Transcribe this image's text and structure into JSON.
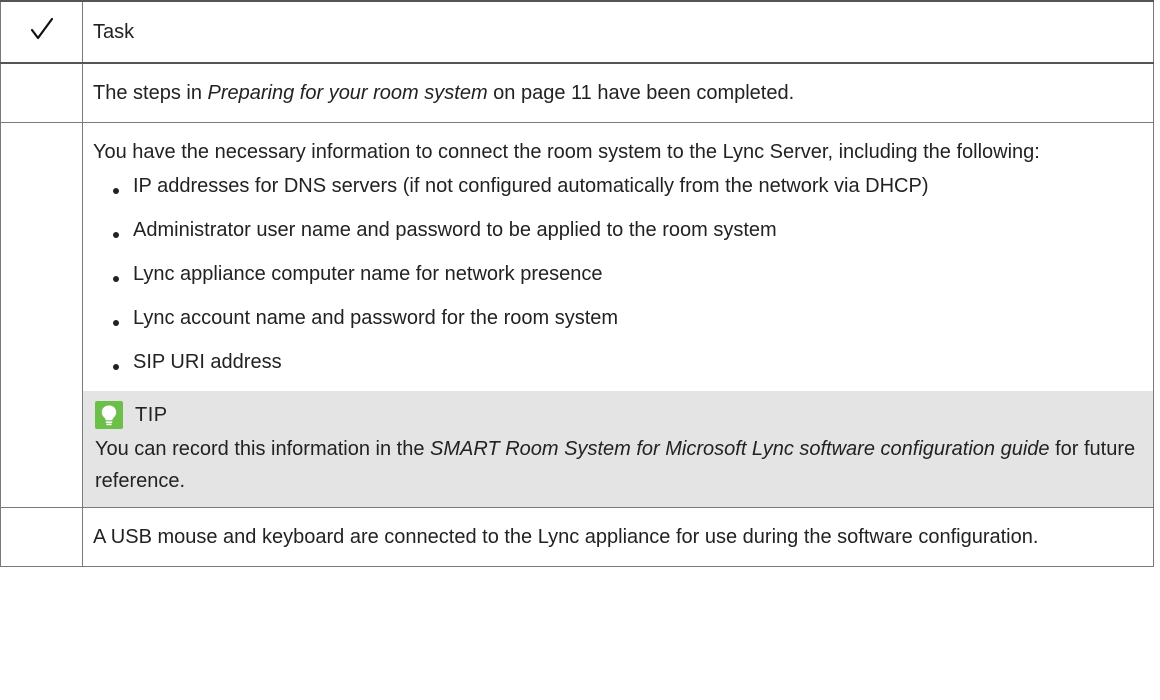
{
  "table": {
    "header": {
      "check_icon": "checkmark-icon",
      "task_label": "Task"
    },
    "rows": [
      {
        "before": "The steps in ",
        "link_text": "Preparing for your room system",
        "after": " on page 11 have been completed."
      },
      {
        "intro": "You have the necessary information to connect the room system to the Lync Server, including the following:",
        "bullets": [
          "IP addresses for DNS servers (if not configured automatically from the network via DHCP)",
          "Administrator user name and password to be applied to the room system",
          "Lync appliance computer name for network presence",
          "Lync account name and password for the room system",
          "SIP URI address"
        ],
        "tip": {
          "icon": "lightbulb-icon",
          "title": "TIP",
          "before": "You can record this information in the ",
          "guide_title": "SMART Room System for Microsoft Lync software configuration guide",
          "after": " for future reference."
        }
      },
      {
        "text": "A USB mouse and keyboard are connected to the Lync appliance for use during the software configuration."
      }
    ]
  },
  "colors": {
    "tip_background": "#e4e4e4",
    "tip_icon": "#6cc04a",
    "border": "#7a7a7a"
  }
}
